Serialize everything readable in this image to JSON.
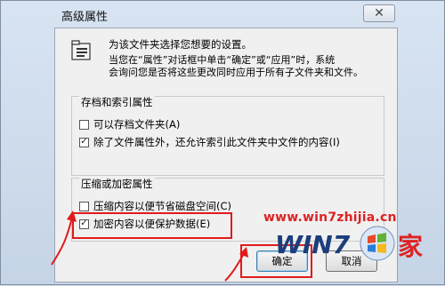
{
  "window": {
    "title": "高级属性"
  },
  "intro": {
    "line1": "为该文件夹选择您想要的设置。",
    "line2": "当您在“属性”对话框中单击“确定”或“应用”时，系统",
    "line3": "会询问您是否将这些更改同时应用于所有子文件夹和文件。"
  },
  "archive_group": {
    "title": "存档和索引属性",
    "options": [
      {
        "label": "可以存档文件夹(A)",
        "checked": false
      },
      {
        "label": "除了文件属性外，还允许索引此文件夹中文件的内容(I)",
        "checked": true
      }
    ]
  },
  "compress_group": {
    "title": "压缩或加密属性",
    "options": [
      {
        "label": "压缩内容以便节省磁盘空间(C)",
        "checked": false
      },
      {
        "label": "加密内容以便保护数据(E)",
        "checked": true
      }
    ]
  },
  "buttons": {
    "ok": "确定",
    "cancel": "取消"
  },
  "watermark": {
    "url": "www.win7zhijia.cn",
    "logo": "WIN7",
    "home": "家"
  },
  "colors": {
    "highlight": "#e11b1b"
  },
  "icons": {
    "close": "close-icon",
    "folder": "folder-properties-icon",
    "check": "check-icon"
  }
}
